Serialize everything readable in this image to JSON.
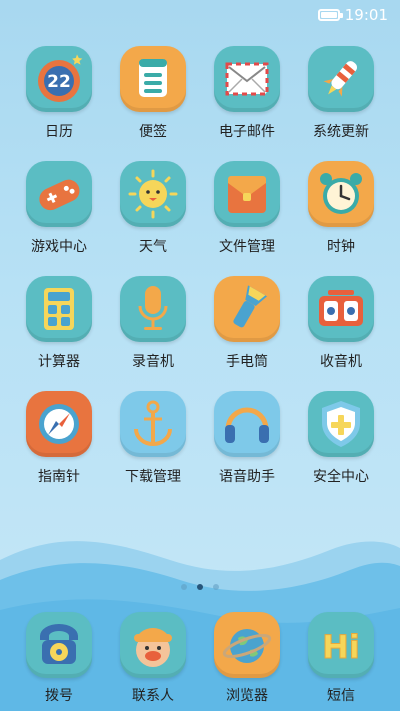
{
  "status": {
    "time": "19:01"
  },
  "apps": [
    {
      "label": "日历",
      "icon": "calendar-icon",
      "date": "22"
    },
    {
      "label": "便签",
      "icon": "notepad-icon"
    },
    {
      "label": "电子邮件",
      "icon": "mail-icon"
    },
    {
      "label": "系统更新",
      "icon": "rocket-icon"
    },
    {
      "label": "游戏中心",
      "icon": "gamepad-icon"
    },
    {
      "label": "天气",
      "icon": "sun-icon"
    },
    {
      "label": "文件管理",
      "icon": "folder-icon"
    },
    {
      "label": "时钟",
      "icon": "alarm-clock-icon"
    },
    {
      "label": "计算器",
      "icon": "calculator-icon"
    },
    {
      "label": "录音机",
      "icon": "microphone-icon"
    },
    {
      "label": "手电筒",
      "icon": "flashlight-icon"
    },
    {
      "label": "收音机",
      "icon": "radio-icon"
    },
    {
      "label": "指南针",
      "icon": "compass-icon"
    },
    {
      "label": "下载管理",
      "icon": "anchor-icon"
    },
    {
      "label": "语音助手",
      "icon": "headphones-icon"
    },
    {
      "label": "安全中心",
      "icon": "shield-icon"
    }
  ],
  "pager": {
    "pages": 3,
    "current": 2
  },
  "dock": [
    {
      "label": "拨号",
      "icon": "phone-icon"
    },
    {
      "label": "联系人",
      "icon": "contact-icon"
    },
    {
      "label": "浏览器",
      "icon": "globe-icon"
    },
    {
      "label": "短信",
      "icon": "message-hi-icon",
      "text": "Hi"
    }
  ],
  "colors": {
    "teal": "#5bbdc3",
    "orange": "#f3a84a",
    "sky": "#7ec9e9",
    "wave": "#5fb8e6"
  }
}
